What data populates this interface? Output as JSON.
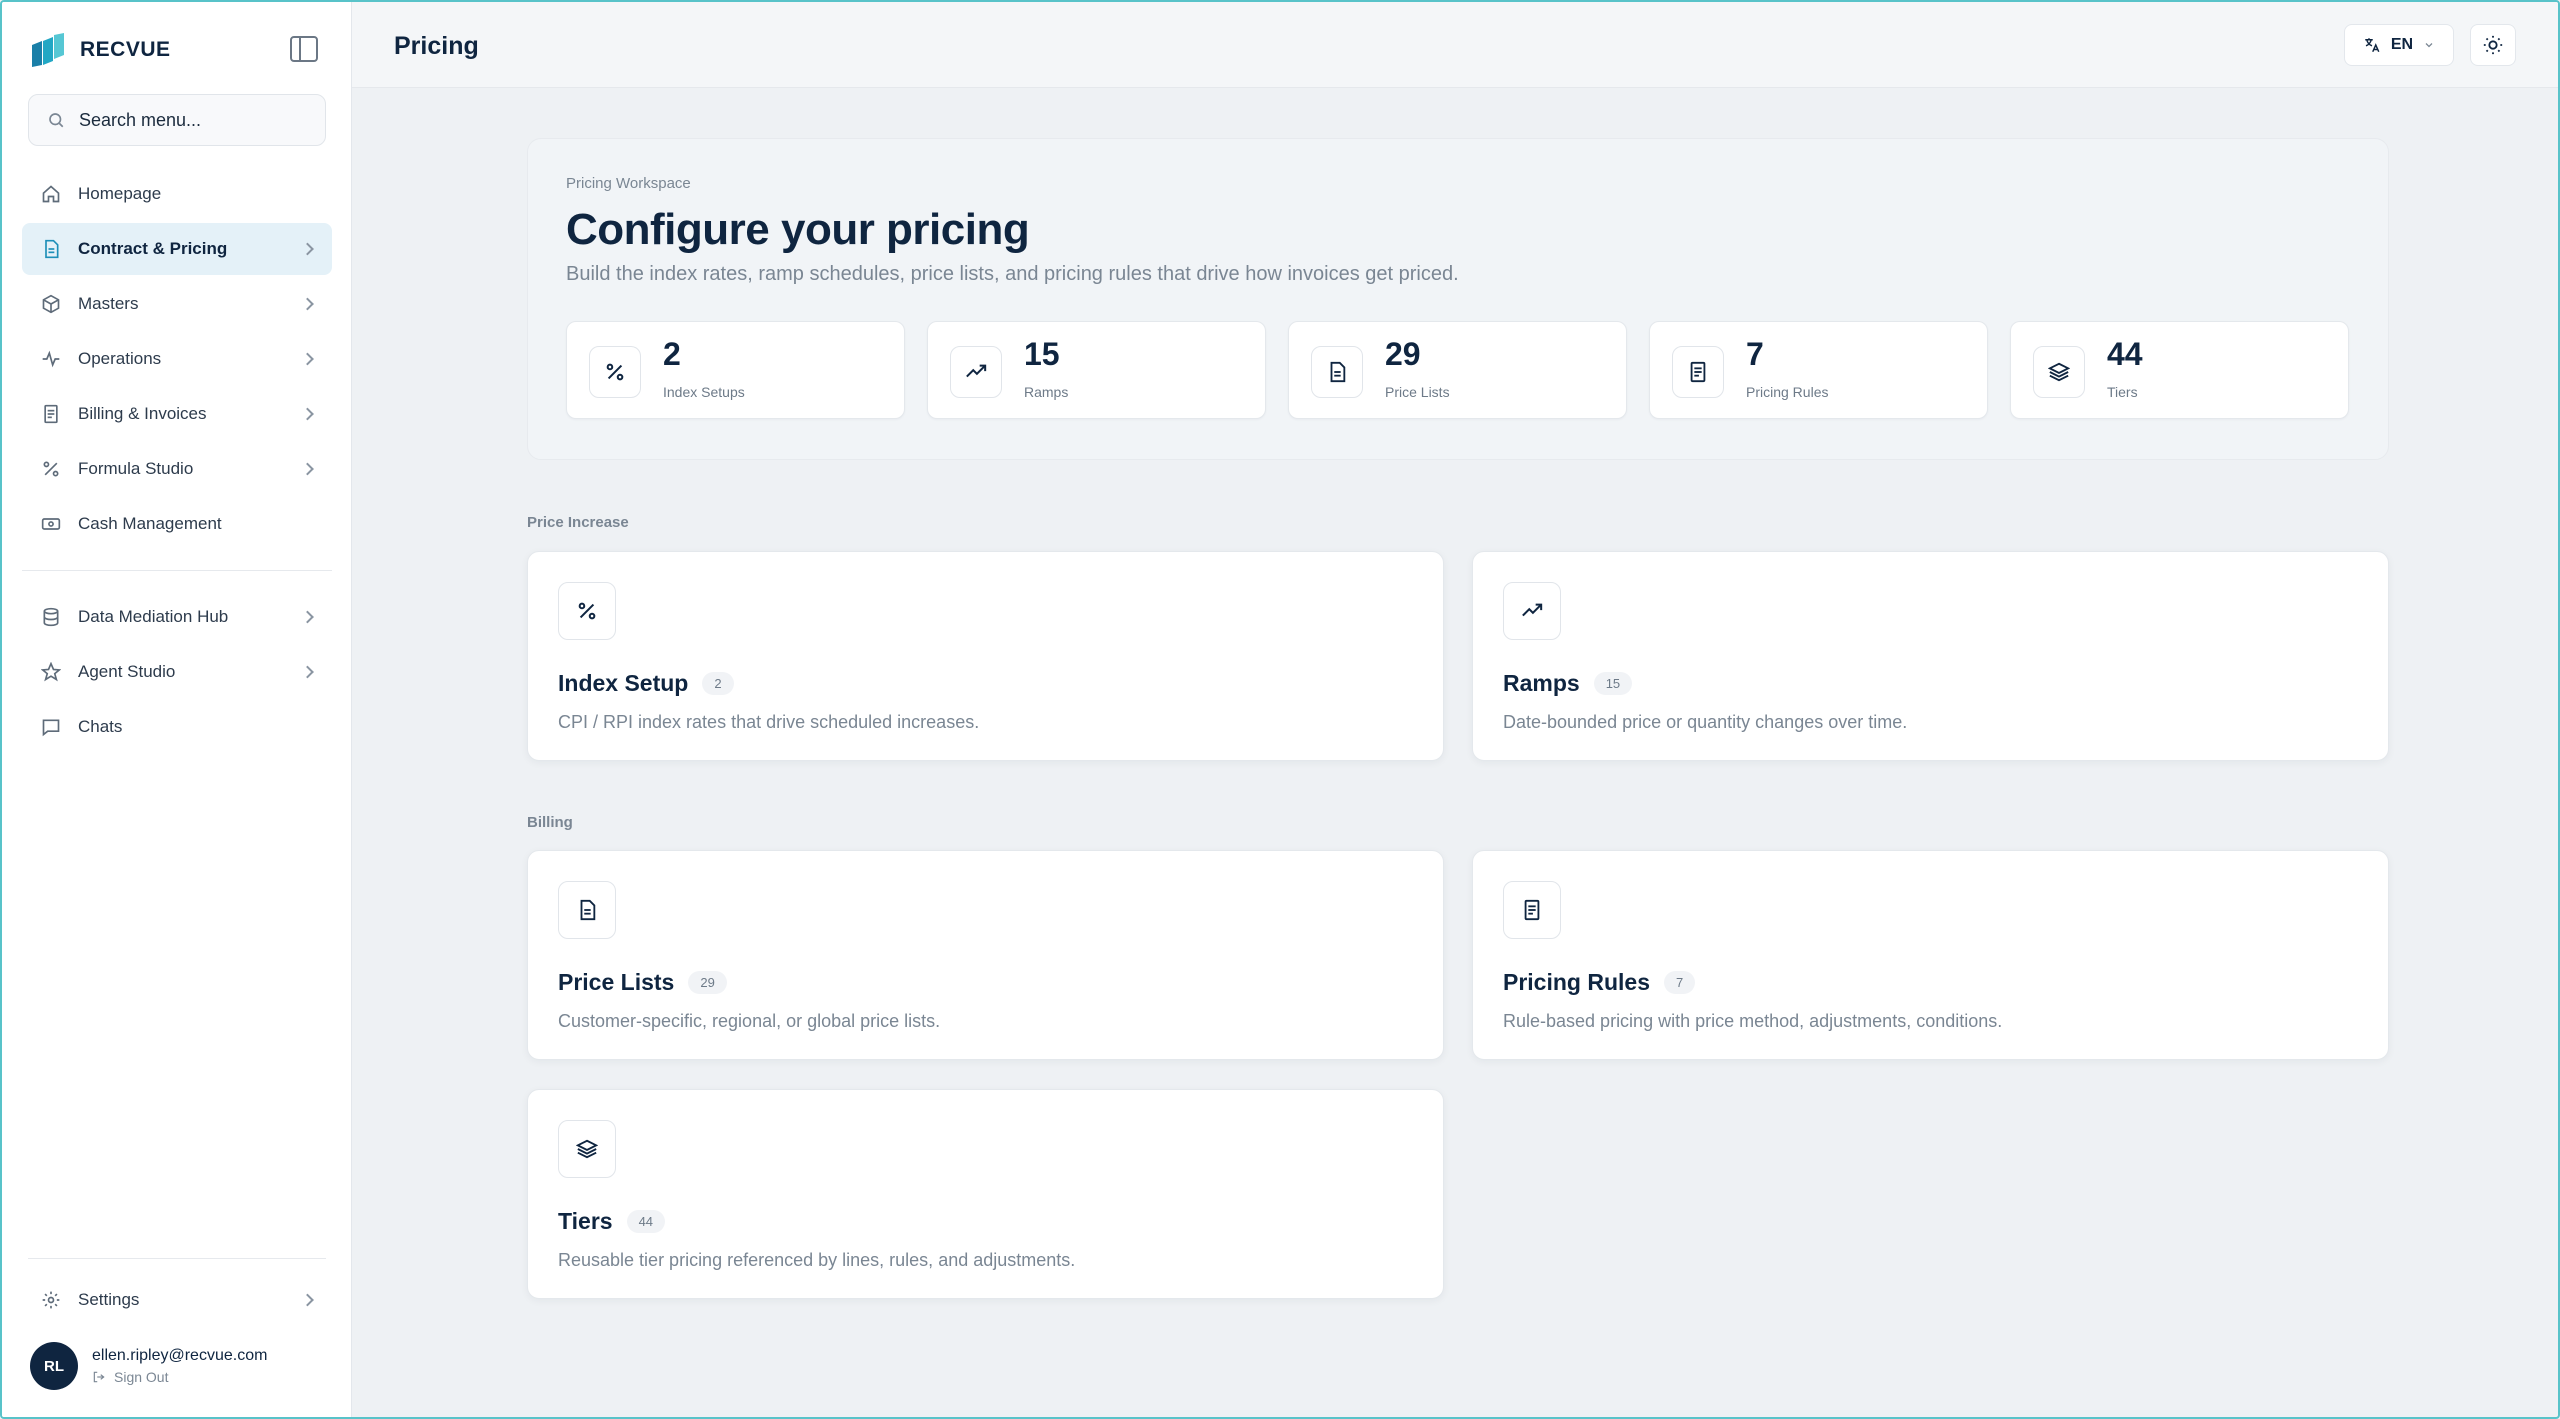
{
  "brand": {
    "name": "RECVUE"
  },
  "search": {
    "placeholder": "Search menu..."
  },
  "nav": {
    "items": [
      {
        "label": "Homepage"
      },
      {
        "label": "Contract & Pricing"
      },
      {
        "label": "Masters"
      },
      {
        "label": "Operations"
      },
      {
        "label": "Billing & Invoices"
      },
      {
        "label": "Formula Studio"
      },
      {
        "label": "Cash Management"
      },
      {
        "label": "Data Mediation Hub"
      },
      {
        "label": "Agent Studio"
      },
      {
        "label": "Chats"
      }
    ],
    "settings_label": "Settings"
  },
  "user": {
    "initials": "RL",
    "email": "ellen.ripley@recvue.com",
    "signout_label": "Sign Out"
  },
  "header": {
    "title": "Pricing",
    "language": "EN"
  },
  "hero": {
    "eyebrow": "Pricing Workspace",
    "title": "Configure your pricing",
    "subtitle": "Build the index rates, ramp schedules, price lists, and pricing rules that drive how invoices get priced.",
    "stats": [
      {
        "value": "2",
        "label": "Index Setups",
        "icon": "percent-icon"
      },
      {
        "value": "15",
        "label": "Ramps",
        "icon": "trending-up-icon"
      },
      {
        "value": "29",
        "label": "Price Lists",
        "icon": "file-text-icon"
      },
      {
        "value": "7",
        "label": "Pricing Rules",
        "icon": "receipt-icon"
      },
      {
        "value": "44",
        "label": "Tiers",
        "icon": "layers-icon"
      }
    ]
  },
  "sections": {
    "price_increase": {
      "label": "Price Increase",
      "cards": [
        {
          "title": "Index Setup",
          "count": "2",
          "description": "CPI / RPI index rates that drive scheduled increases."
        },
        {
          "title": "Ramps",
          "count": "15",
          "description": "Date-bounded price or quantity changes over time."
        }
      ]
    },
    "billing": {
      "label": "Billing",
      "cards": [
        {
          "title": "Price Lists",
          "count": "29",
          "description": "Customer-specific, regional, or global price lists."
        },
        {
          "title": "Pricing Rules",
          "count": "7",
          "description": "Rule-based pricing with price method, adjustments, conditions."
        },
        {
          "title": "Tiers",
          "count": "44",
          "description": "Reusable tier pricing referenced by lines, rules, and adjustments."
        }
      ]
    }
  },
  "colors": {
    "accent": "#1d8fb8",
    "navy": "#0f2540",
    "active_bg": "#e4f1f8",
    "frame": "#58c3c9"
  }
}
